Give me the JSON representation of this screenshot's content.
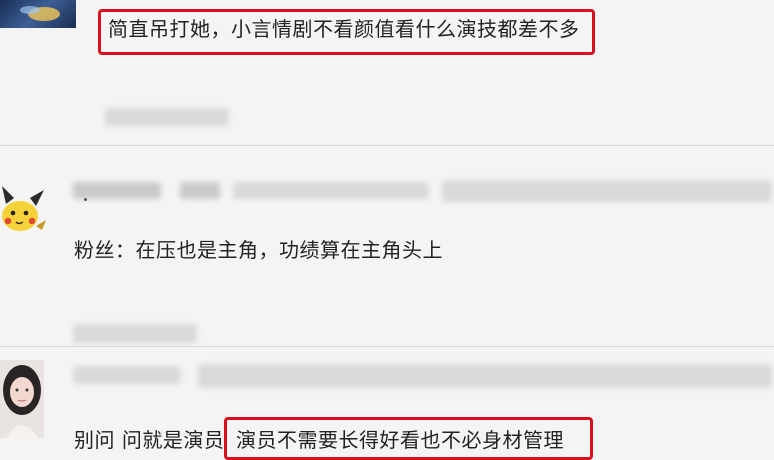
{
  "comments": [
    {
      "text": "简直吊打她，小言情剧不看颜值看什么演技都差不多",
      "highlighted": true
    },
    {
      "prefix": "粉丝：",
      "text": "在压也是主角，功绩算在主角头上",
      "highlighted": false
    },
    {
      "prefix": "别问 问就是演员",
      "text": "演员不需要长得好看也不必身材管理",
      "highlighted": true
    }
  ],
  "colors": {
    "highlight_border": "#d8101e",
    "background": "#f4f4f4",
    "text": "#222222"
  },
  "icons": [
    "user-avatar-1",
    "pikachu-avatar",
    "user-avatar-3"
  ]
}
